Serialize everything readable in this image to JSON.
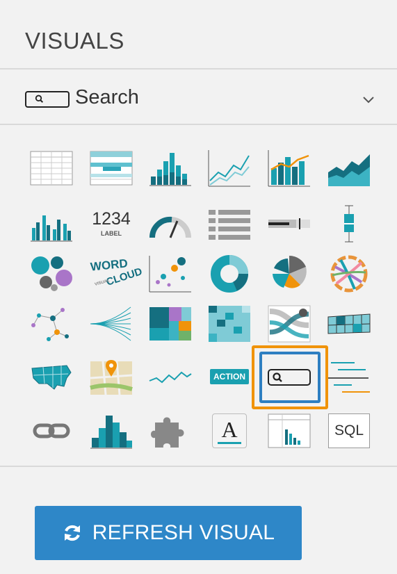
{
  "panel": {
    "title": "VISUALS"
  },
  "search": {
    "label": "Search"
  },
  "tiles": {
    "kpi_number": "1234",
    "kpi_label": "LABEL",
    "word_cloud_1": "WORD",
    "word_cloud_2": "CLOUD",
    "word_cloud_3": "VISUAL",
    "action": "ACTION",
    "rich_text": "A",
    "sql": "SQL"
  },
  "footer": {
    "refresh_label": "REFRESH VISUAL"
  },
  "colors": {
    "teal": "#1aa0b0",
    "dark_teal": "#156f80",
    "orange": "#f0930a",
    "blue": "#2e87c8"
  }
}
